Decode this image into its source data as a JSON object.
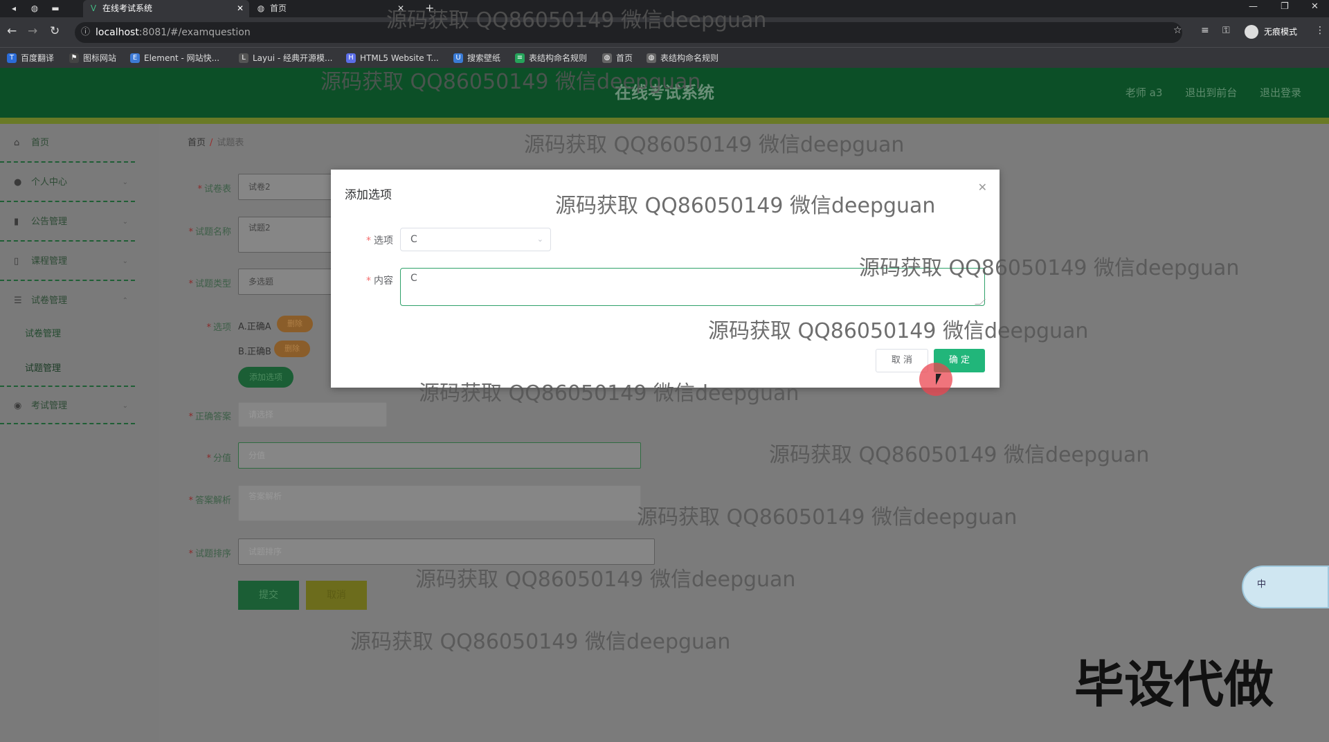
{
  "browser": {
    "tabs": [
      {
        "title": "在线考试系统",
        "active": true
      },
      {
        "title": "首页",
        "active": false
      }
    ],
    "url_host": "localhost",
    "url_path": ":8081/#/examquestion",
    "incognito_label": "无痕模式",
    "bookmarks": [
      {
        "label": "百度翻译",
        "icon_color": "#2b6cd8"
      },
      {
        "label": "图标网站",
        "icon_color": "#444444"
      },
      {
        "label": "Element - 网站快...",
        "icon_color": "#3d7ad6"
      },
      {
        "label": "Layui - 经典开源模...",
        "icon_color": "#555555"
      },
      {
        "label": "HTML5 Website T...",
        "icon_color": "#5b6ee8"
      },
      {
        "label": "搜索壁纸",
        "icon_color": "#3a7bd5"
      },
      {
        "label": "表结构命名规则",
        "icon_color": "#25a35a"
      },
      {
        "label": "首页",
        "icon_color": "#666666"
      },
      {
        "label": "表结构命名规则",
        "icon_color": "#666666"
      }
    ]
  },
  "header": {
    "title": "在线考试系统",
    "links": [
      "老师 a3",
      "退出到前台",
      "退出登录"
    ]
  },
  "sidebar": {
    "items": [
      {
        "label": "首页",
        "icon": "home-icon"
      },
      {
        "label": "个人中心",
        "icon": "user-icon"
      },
      {
        "label": "公告管理",
        "icon": "chart-icon"
      },
      {
        "label": "课程管理",
        "icon": "phone-icon"
      },
      {
        "label": "试卷管理",
        "icon": "list-icon"
      },
      {
        "label": "考试管理",
        "icon": "pin-icon"
      }
    ],
    "subitems": [
      "试卷管理",
      "试题管理"
    ]
  },
  "breadcrumb": {
    "home": "首页",
    "current": "试题表"
  },
  "form": {
    "labels": {
      "paper": "试卷表",
      "name": "试题名称",
      "type": "试题类型",
      "options": "选项",
      "answer": "正确答案",
      "score": "分值",
      "analysis": "答案解析",
      "order": "试题排序"
    },
    "values": {
      "paper": "试卷2",
      "name": "试题2",
      "type": "多选题"
    },
    "placeholders": {
      "answer": "请选择",
      "score": "分值",
      "analysis": "答案解析",
      "order": "试题排序"
    },
    "option_rows": [
      {
        "text": "A.正确A",
        "delete_label": "删除"
      },
      {
        "text": "B.正确B",
        "delete_label": "删除"
      }
    ],
    "add_option_label": "添加选项",
    "submit_label": "提交",
    "cancel_label": "取消"
  },
  "dialog": {
    "title": "添加选项",
    "option_label": "选项",
    "option_value": "C",
    "content_label": "内容",
    "content_value": "C",
    "cancel_label": "取 消",
    "confirm_label": "确 定"
  },
  "watermark": {
    "text": "源码获取 QQ86050149 微信deepguan",
    "banner": "毕设代做"
  },
  "ime": {
    "label": "中"
  }
}
